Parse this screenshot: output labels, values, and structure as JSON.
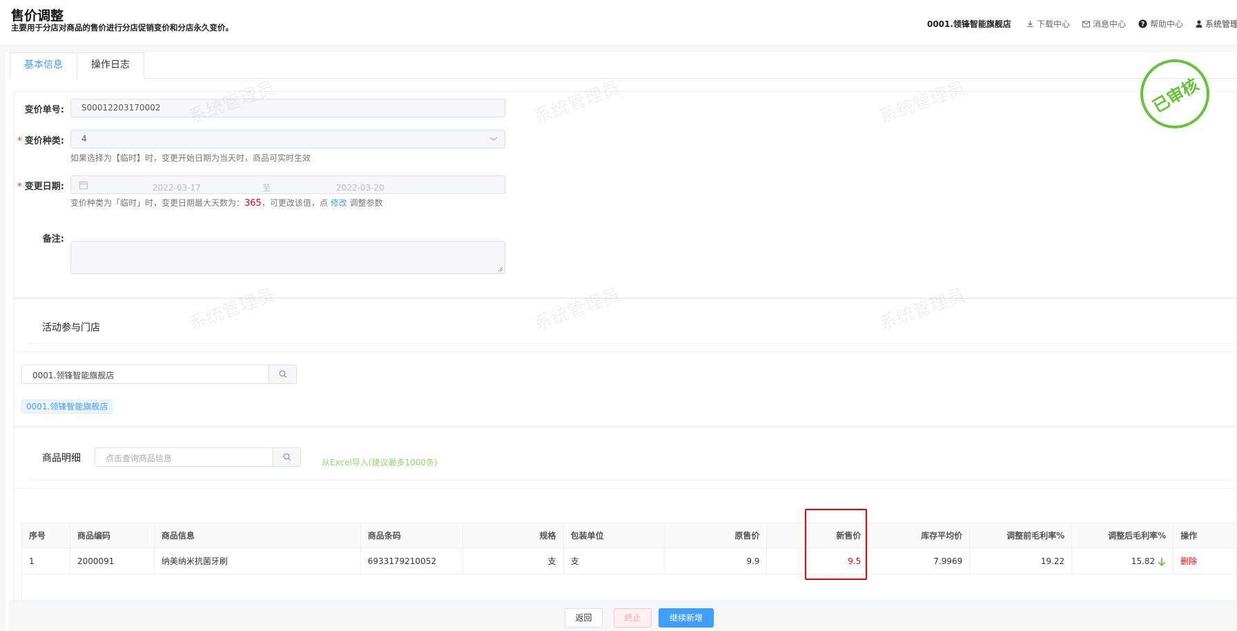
{
  "header": {
    "title": "售价调整",
    "subtitle": "主要用于分店对商品的售价进行分店促销变价和分店永久变价。",
    "store": "0001.领锋智能旗舰店",
    "links": [
      "下载中心",
      "消息中心",
      "帮助中心",
      "系统管理员"
    ]
  },
  "tabs": [
    "基本信息",
    "操作日志"
  ],
  "stamp": "已审核",
  "watermark": "系统管理员",
  "form": {
    "order_no_label": "变价单号:",
    "order_no": "S00012203170002",
    "type_label": "变价种类:",
    "type_value": "4",
    "type_hint": "如果选择为【临时】时，变更开始日期为当天时，商品可实时生效",
    "date_label": "变更日期:",
    "date_start": "2022-03-17",
    "date_sep": "至",
    "date_end": "2022-03-20",
    "date_hint_pre": "变价种类为「临时」时，变更日期最大天数为：",
    "date_hint_days": "365",
    "date_hint_mid": "，可更改该值，点",
    "date_hint_link": "修改",
    "date_hint_post": "调整参数",
    "remark_label": "备注:"
  },
  "stores": {
    "title": "活动参与门店",
    "search_value": "0001.领锋智能旗舰店",
    "tag": "0001.领锋智能旗舰店"
  },
  "goods": {
    "title": "商品明细",
    "search_placeholder": "点击查询商品信息",
    "excel_link": "从Excel导入(建议最多1000条)",
    "columns": [
      "序号",
      "商品编码",
      "商品信息",
      "商品条码",
      "规格",
      "包装单位",
      "原售价",
      "新售价",
      "库存平均价",
      "调整前毛利率%",
      "调整后毛利率%",
      "操作"
    ],
    "rows": [
      {
        "seq": "1",
        "code": "2000091",
        "info": "纳美纳米抗菌牙刷",
        "barcode": "6933179210052",
        "spec": "支",
        "unit": "支",
        "old_price": "9.9",
        "new_price": "9.5",
        "avg_cost": "7.9969",
        "margin_before": "19.22",
        "margin_after": "15.82",
        "action": "删除"
      }
    ]
  },
  "footer": {
    "back": "返回",
    "stop": "终止",
    "continue": "继续新增"
  },
  "colors": {
    "accent": "#409eff",
    "stamp": "#67c23a",
    "danger": "#ff0000"
  }
}
